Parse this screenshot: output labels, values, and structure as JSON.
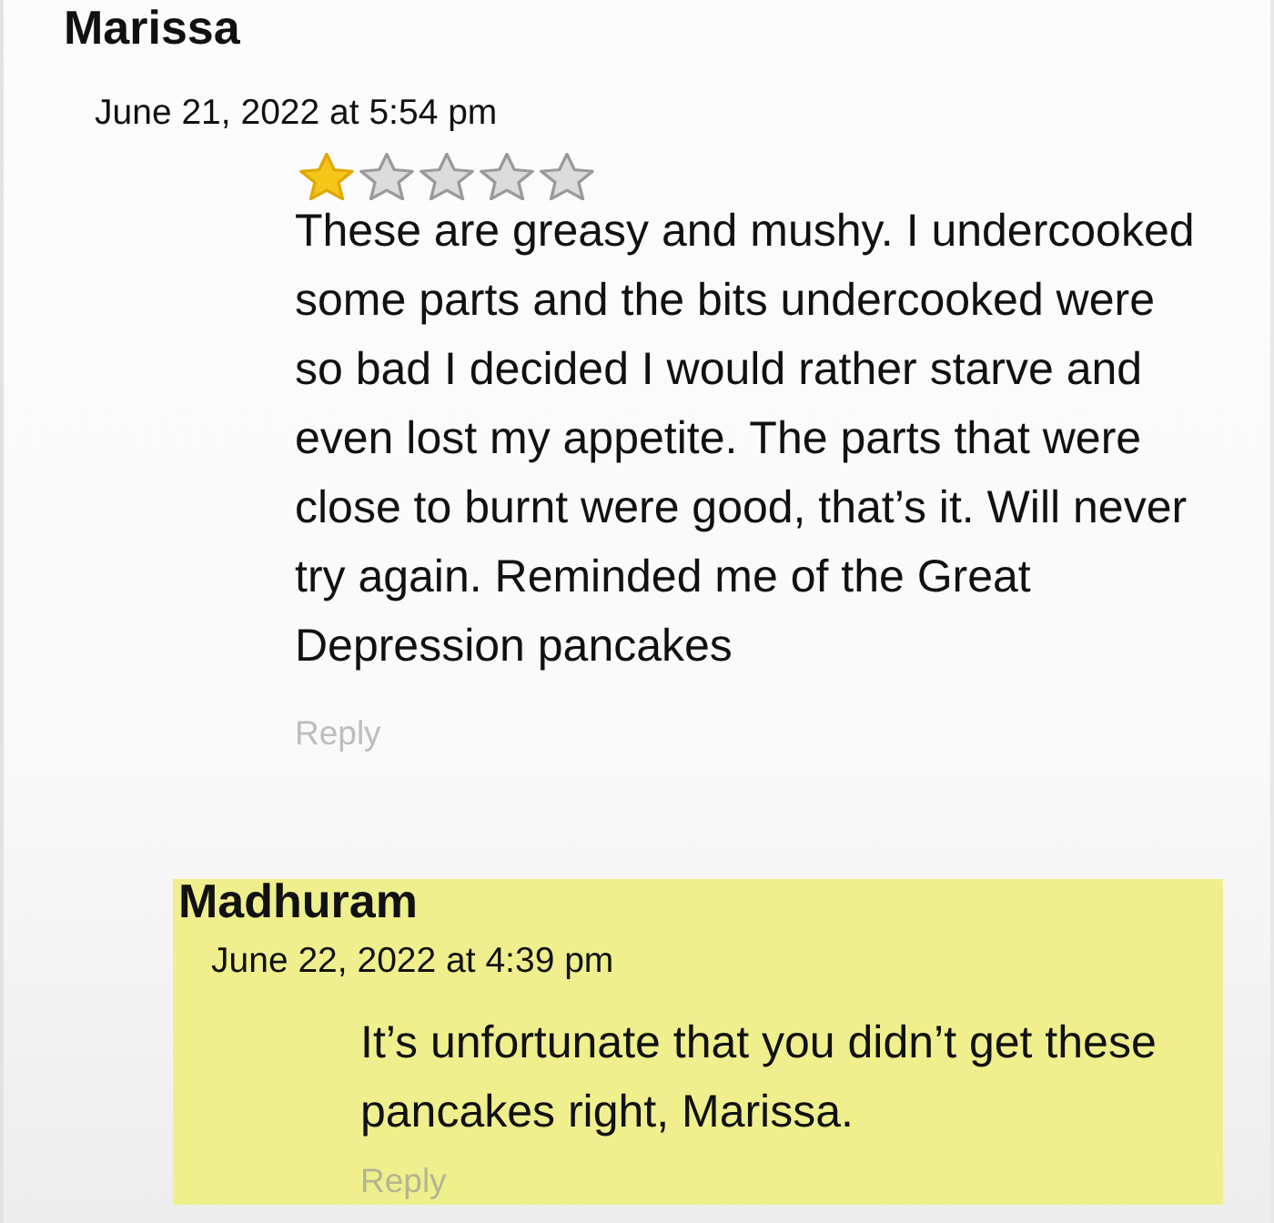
{
  "review": {
    "author": "Marissa",
    "date": "June 21, 2022 at 5:54 pm",
    "stars": 1,
    "text": "These are greasy and mushy. I undercooked some parts and the bits undercooked were so bad I decided I would rather starve and even lost my appetite. The parts that were close to burnt were good, that’s it. Will never try again. Reminded me of the Great Depression pancakes",
    "reply_link": "Reply"
  },
  "response": {
    "author": "Madhuram",
    "date": "June 22, 2022 at 4:39 pm",
    "text": "It’s unfortunate that you didn’t get these pancakes right, Marissa.",
    "reply_link": "Reply"
  }
}
